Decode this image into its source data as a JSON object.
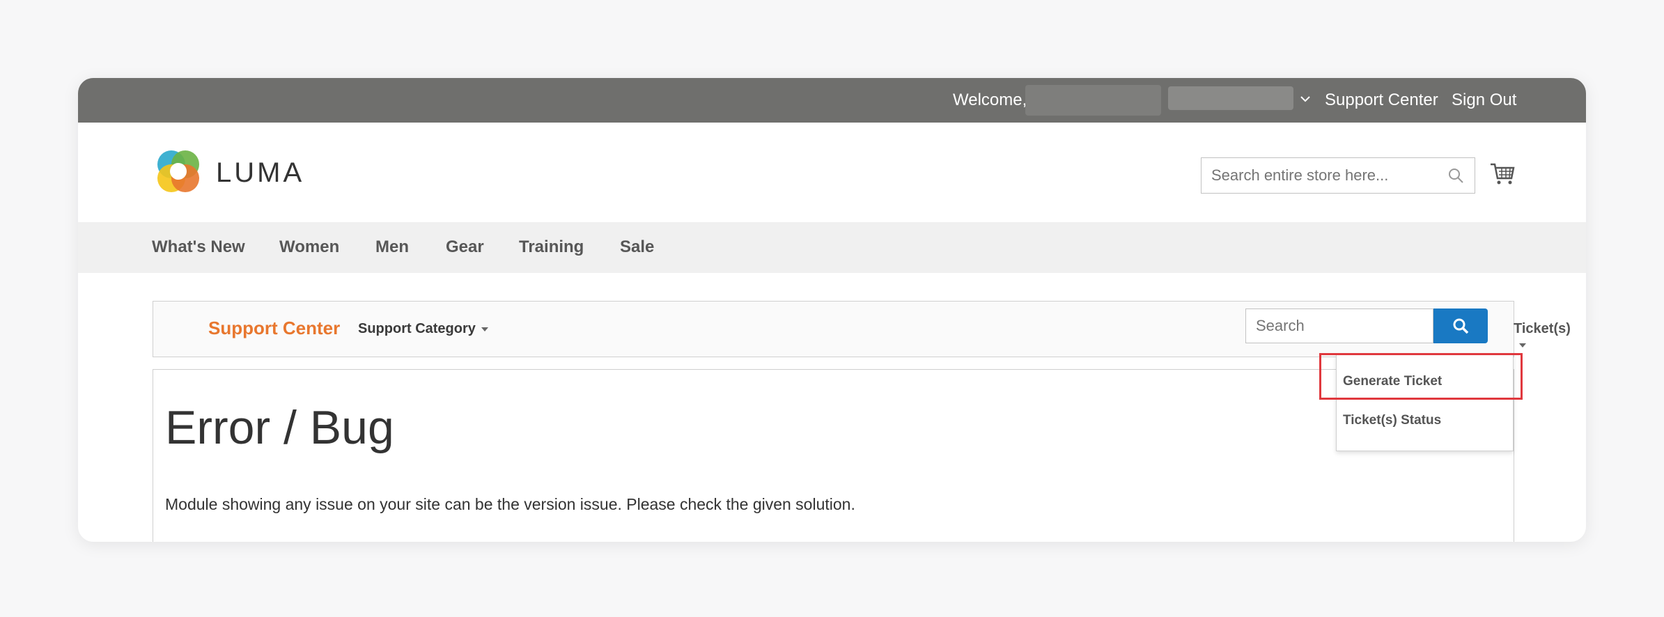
{
  "topbar": {
    "welcome": "Welcome,",
    "support_center": "Support Center",
    "sign_out": "Sign Out"
  },
  "header": {
    "logo_text": "LUMA",
    "search_placeholder": "Search entire store here..."
  },
  "nav": {
    "items": [
      {
        "label": "What's New"
      },
      {
        "label": "Women"
      },
      {
        "label": "Men"
      },
      {
        "label": "Gear"
      },
      {
        "label": "Training"
      },
      {
        "label": "Sale"
      }
    ]
  },
  "support_bar": {
    "title": "Support Center",
    "category": "Support Category",
    "search_placeholder": "Search",
    "tickets": "Ticket(s)"
  },
  "dropdown": {
    "items": [
      {
        "label": "Generate Ticket"
      },
      {
        "label": "Ticket(s) Status"
      }
    ]
  },
  "content": {
    "title": "Error / Bug",
    "text": "Module showing any issue on your site can be the version issue. Please check the given solution."
  },
  "colors": {
    "topbar": "#6f6f6d",
    "accent_orange": "#e8772e",
    "button_blue": "#1979c3",
    "highlight_red": "#e0383e"
  }
}
